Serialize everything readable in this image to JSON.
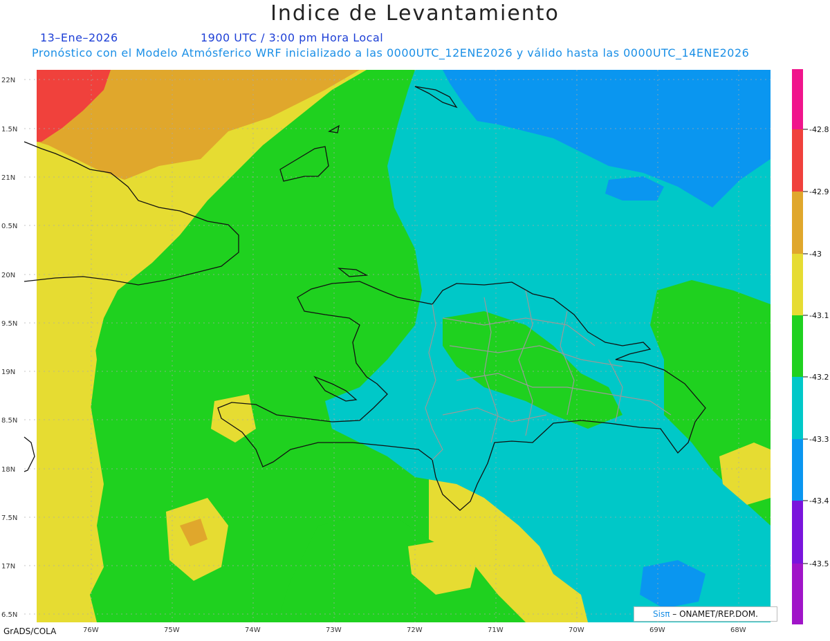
{
  "title": "Indice de Levantamiento",
  "subtitle": {
    "date": "13–Ene–2026",
    "time": "1900 UTC / 3:00 pm Hora Local",
    "model": "Pronóstico con el Modelo Atmósferico WRF inicializado a las 0000UTC_12ENE2026 y válido hasta las  0000UTC_14ENE2026"
  },
  "map": {
    "lat_labels": [
      "22N",
      "1.5N",
      "21N",
      "0.5N",
      "20N",
      "9.5N",
      "19N",
      "8.5N",
      "18N",
      "7.5N",
      "17N",
      "6.5N"
    ],
    "lon_labels": [
      "76W",
      "75W",
      "74W",
      "73W",
      "72W",
      "71W",
      "70W",
      "69W",
      "68W"
    ],
    "field_colors": {
      "orange": "#e0a72c",
      "red": "#f0413c",
      "yellow": "#e6dc32",
      "green": "#1fd11f",
      "cyan": "#00c8c8",
      "blue": "#0a96f0"
    }
  },
  "colorbar": {
    "labels": [
      "-42.8",
      "-42.9",
      "-43",
      "-43.1",
      "-43.2",
      "-43.3",
      "-43.4",
      "-43.5"
    ],
    "colors": [
      "#f0148c",
      "#f0413c",
      "#e0a72c",
      "#e6dc32",
      "#1fd11f",
      "#00c8c8",
      "#0a96f0",
      "#7a14dc",
      "#a014c8"
    ]
  },
  "credit": {
    "logo": "Sisπ",
    "org": "– ONAMET/REP.DOM."
  },
  "footer": "GrADS/COLA"
}
